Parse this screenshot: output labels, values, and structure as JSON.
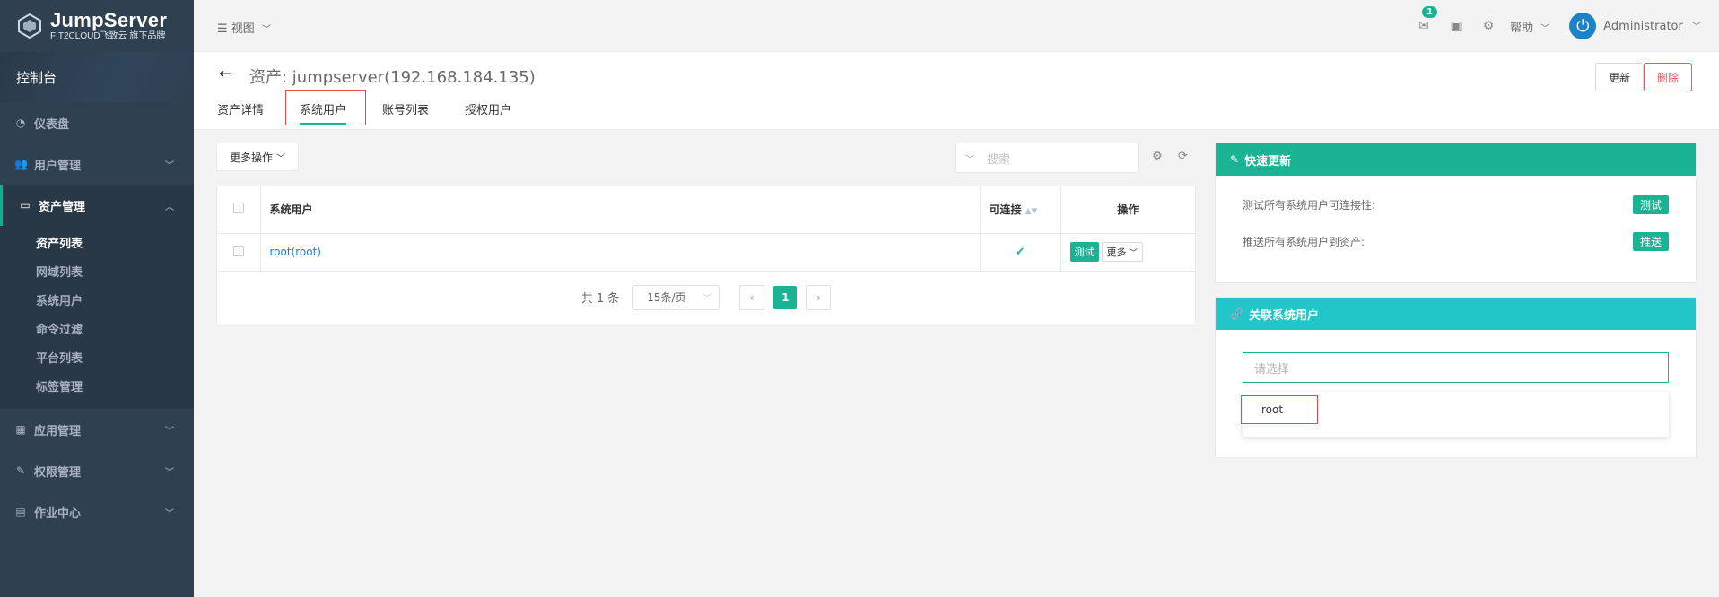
{
  "brand": {
    "title": "JumpServer",
    "subtitle": "FIT2CLOUD飞致云 旗下品牌"
  },
  "sidebar": {
    "console": "控制台",
    "items": [
      {
        "label": "仪表盘",
        "icon": "dashboard-icon"
      },
      {
        "label": "用户管理",
        "icon": "users-icon"
      },
      {
        "label": "资产管理",
        "icon": "inbox-icon"
      },
      {
        "label": "应用管理",
        "icon": "grid-icon"
      },
      {
        "label": "权限管理",
        "icon": "edit-icon"
      },
      {
        "label": "作业中心",
        "icon": "terminal-icon"
      }
    ],
    "submenu": [
      "资产列表",
      "网域列表",
      "系统用户",
      "命令过滤",
      "平台列表",
      "标签管理"
    ]
  },
  "topbar": {
    "view": "视图",
    "mail_badge": "1",
    "help": "帮助",
    "user": "Administrator"
  },
  "page": {
    "title": "资产: jumpserver(192.168.184.135)",
    "update": "更新",
    "delete": "删除",
    "tabs": [
      "资产详情",
      "系统用户",
      "账号列表",
      "授权用户"
    ]
  },
  "toolbar": {
    "more_ops": "更多操作",
    "search_placeholder": "搜索"
  },
  "table": {
    "headers": [
      "系统用户",
      "可连接",
      "操作"
    ],
    "rows": [
      {
        "user": "root(root)",
        "connectable": "✔",
        "test": "测试",
        "more": "更多"
      }
    ]
  },
  "pager": {
    "total": "共 1 条",
    "page_size": "15条/页",
    "current": "1"
  },
  "quick_update": {
    "title": "快速更新",
    "rows": [
      {
        "label": "测试所有系统用户可连接性:",
        "button": "测试"
      },
      {
        "label": "推送所有系统用户到资产:",
        "button": "推送"
      }
    ]
  },
  "relate": {
    "title": "关联系统用户",
    "placeholder": "请选择",
    "option": "root"
  },
  "colors": {
    "sidebar": "#2f4050",
    "primary": "#1ab394",
    "teal": "#23c6c8",
    "danger": "#ed5565",
    "link": "#1c84c6"
  }
}
